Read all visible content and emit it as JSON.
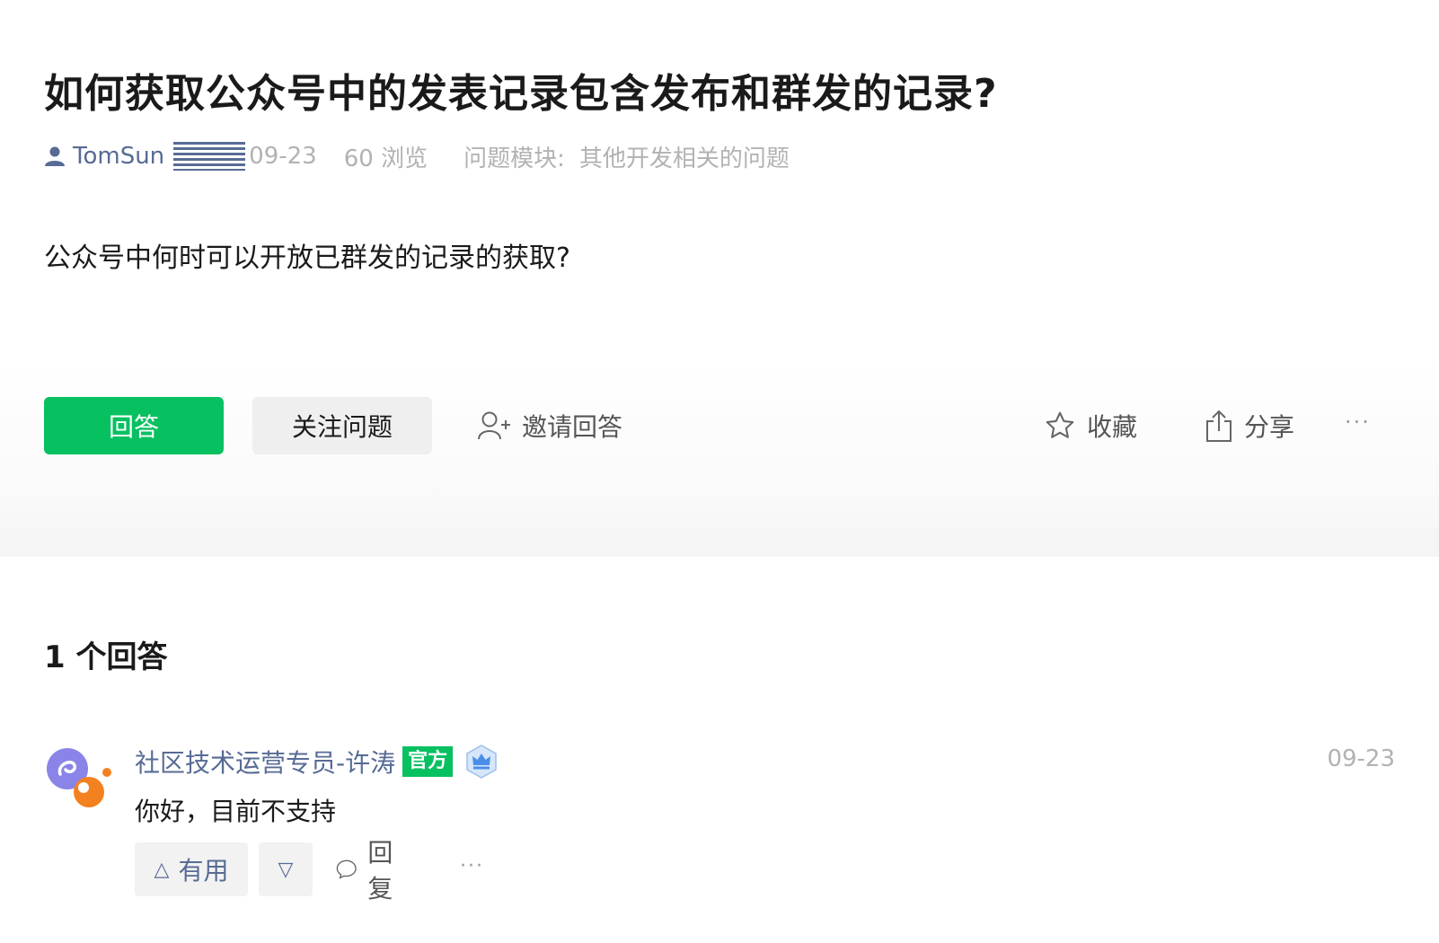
{
  "question": {
    "title": "如何获取公众号中的发表记录包含发布和群发的记录?",
    "author": "TomSun",
    "date": "09-23",
    "views": "60 浏览",
    "module_label": "问题模块:",
    "module_value": "其他开发相关的问题",
    "body": "公众号中何时可以开放已群发的记录的获取?"
  },
  "actions": {
    "answer_label": "回答",
    "follow_label": "关注问题",
    "invite_label": "邀请回答",
    "collect_label": "收藏",
    "share_label": "分享",
    "more_label": "···"
  },
  "answers": {
    "heading": "1 个回答",
    "items": [
      {
        "author": "社区技术运营专员-许涛",
        "badge": "官方",
        "date": "09-23",
        "content": "你好，目前不支持",
        "useful_label": "有用",
        "down_label": "▽",
        "reply_label": "回复",
        "more_label": "···"
      }
    ]
  },
  "colors": {
    "primary": "#07c160",
    "link": "#576b95",
    "muted": "#b2b2b2"
  }
}
